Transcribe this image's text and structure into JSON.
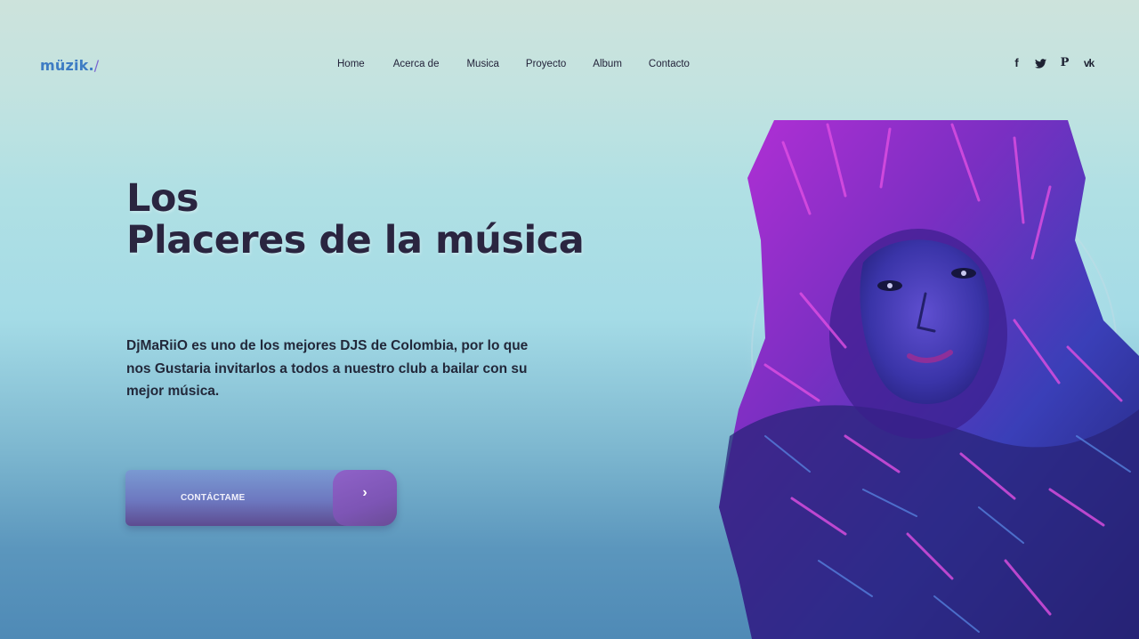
{
  "brand": {
    "logo_text": "müzik.",
    "logo_slash": "/",
    "logo_color": "#3d7cc4"
  },
  "nav": {
    "items": [
      {
        "label": "Home"
      },
      {
        "label": "Acerca de"
      },
      {
        "label": "Musica"
      },
      {
        "label": "Proyecto"
      },
      {
        "label": "Album"
      },
      {
        "label": "Contacto"
      }
    ]
  },
  "social": {
    "icons": [
      "facebook-icon",
      "twitter-icon",
      "pinterest-icon",
      "vk-icon"
    ],
    "facebook": "f",
    "pinterest": "P",
    "vk": "vk"
  },
  "hero": {
    "title_line1": "Los",
    "title_line2": "Placeres de la música",
    "description": "DjMaRiiO es uno de los mejores DJS de Colombia, por lo que nos Gustaria invitarlos a todos a nuestro club a bailar con su mejor música.",
    "cta_label": "CONTÁCTAME",
    "cta_arrow": "›"
  },
  "colors": {
    "title": "#2a2540",
    "accent_purple": "#7b66d1",
    "button": "#6d78c0"
  }
}
